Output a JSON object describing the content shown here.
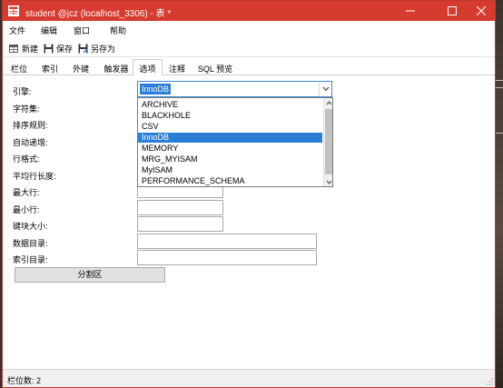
{
  "window": {
    "title": "student @jcz (localhost_3306) - 表 *"
  },
  "menubar": {
    "items": [
      "文件",
      "编辑",
      "窗口",
      "帮助"
    ]
  },
  "toolbar": {
    "new_label": "新建",
    "save_label": "保存",
    "save_as_label": "另存为"
  },
  "tabs": [
    "栏位",
    "索引",
    "外键",
    "触发器",
    "选项",
    "注释",
    "SQL 预览"
  ],
  "active_tab": "选项",
  "form": {
    "labels": {
      "engine": "引擎:",
      "charset": "字符集:",
      "collation": "排序规则:",
      "auto_increment": "自动递增:",
      "row_format": "行格式:",
      "avg_row_length": "平均行长度:",
      "max_rows": "最大行:",
      "min_rows": "最小行:",
      "key_block_size": "键块大小:",
      "data_directory": "数据目录:",
      "index_directory": "索引目录:"
    },
    "engine_value": "InnoDB",
    "engine_options": [
      "ARCHIVE",
      "BLACKHOLE",
      "CSV",
      "InnoDB",
      "MEMORY",
      "MRG_MYISAM",
      "MyISAM",
      "PERFORMANCE_SCHEMA"
    ],
    "partition_button": "分割区"
  },
  "status": {
    "text": "栏位数: 2"
  },
  "colors": {
    "titlebar": "#d63b2f",
    "selection": "#2a7ed6"
  }
}
